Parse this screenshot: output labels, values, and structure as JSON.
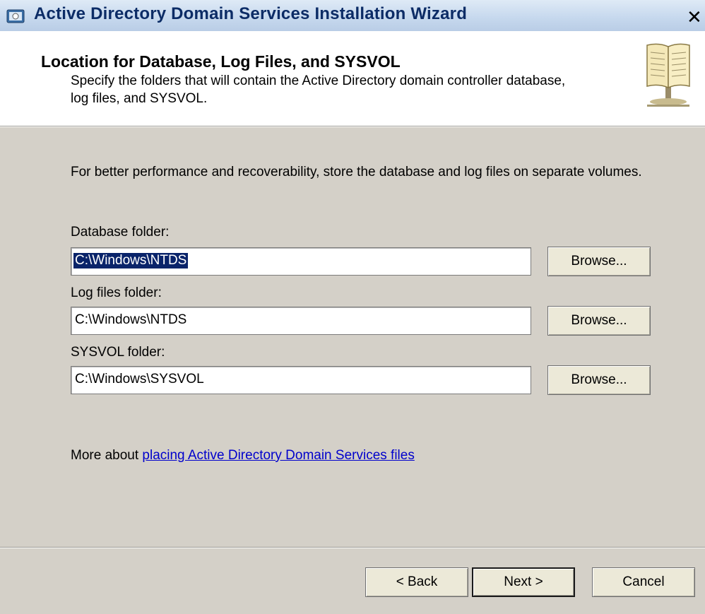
{
  "window": {
    "title": "Active Directory Domain Services Installation Wizard",
    "close_glyph": "✕"
  },
  "header": {
    "title": "Location for Database, Log Files, and SYSVOL",
    "description": "Specify the folders that will contain the Active Directory domain controller database, log files, and SYSVOL.",
    "icon": "book-icon"
  },
  "intro": "For better performance and recoverability, store the database and log files on separate volumes.",
  "fields": {
    "database": {
      "label": "Database folder:",
      "value": "C:\\Windows\\NTDS",
      "browse_label": "Browse..."
    },
    "logs": {
      "label": "Log files folder:",
      "value": "C:\\Windows\\NTDS",
      "browse_label": "Browse..."
    },
    "sysvol": {
      "label": "SYSVOL folder:",
      "value": "C:\\Windows\\SYSVOL",
      "browse_label": "Browse..."
    }
  },
  "more": {
    "prefix": "More about ",
    "link": "placing Active Directory Domain Services files"
  },
  "footer": {
    "back_label": "< Back",
    "next_label": "Next >",
    "cancel_label": "Cancel"
  },
  "colors": {
    "dialog_bg": "#d4d0c8",
    "selection": "#0a246a",
    "link": "#0000cc"
  }
}
